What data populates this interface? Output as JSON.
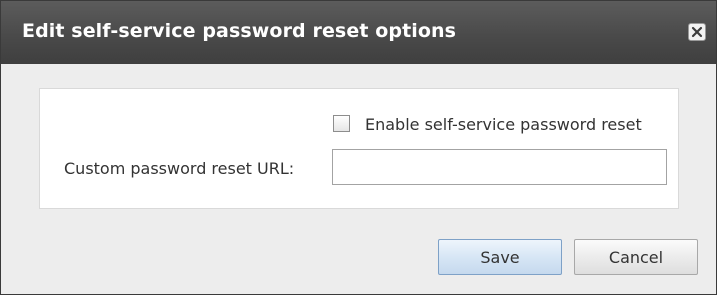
{
  "dialog": {
    "title": "Edit self-service password reset options",
    "close_icon": "close-icon"
  },
  "form": {
    "enable_checkbox": {
      "label": "Enable self-service password reset",
      "checked": false
    },
    "custom_url": {
      "label": "Custom password reset URL:",
      "value": "",
      "placeholder": ""
    }
  },
  "buttons": {
    "save_label": "Save",
    "cancel_label": "Cancel"
  },
  "colors": {
    "titlebar": "#4a4a4a",
    "title_text": "#ffffff",
    "dialog_background": "#ededed",
    "panel_background": "#ffffff",
    "save_button": "#d7e6f5",
    "cancel_button": "#ececec"
  }
}
